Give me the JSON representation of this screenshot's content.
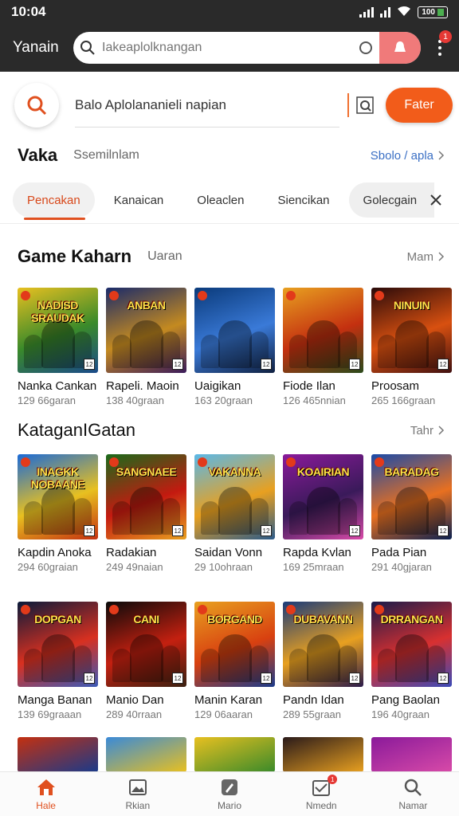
{
  "status_bar": {
    "time": "10:04",
    "battery": "100"
  },
  "header": {
    "app_title": "Yanain",
    "search_placeholder": "Iakeaplolknangan",
    "notification_count": "1"
  },
  "search_bar": {
    "query": "Balo Aplolananieli napian",
    "button_label": "Fater"
  },
  "section_main": {
    "title": "Vaka",
    "subtitle": "Ssemilnlam",
    "more_label": "Sbolo / apla"
  },
  "tabs": [
    {
      "label": "Pencakan",
      "active": true
    },
    {
      "label": "Kanaican",
      "active": false
    },
    {
      "label": "Oleaclen",
      "active": false
    },
    {
      "label": "Siencikan",
      "active": false
    },
    {
      "label": "Golecgain",
      "active": false
    }
  ],
  "section_games": {
    "title": "Game Kaharn",
    "subtitle": "Uaran",
    "more_label": "Mam"
  },
  "row1": [
    {
      "name": "Nanka Cankan",
      "meta": "129 66garan",
      "cover_title": "NADISD SRAUDAK",
      "colors": [
        "#e8c020",
        "#3a8a2a",
        "#1a4a8a"
      ]
    },
    {
      "name": "Rapeli. Maoin",
      "meta": "138 40graan",
      "cover_title": "ANBAN",
      "colors": [
        "#1a2a6a",
        "#c48a20",
        "#3a1a5a"
      ]
    },
    {
      "name": "Uaigikan",
      "meta": "163 20graan",
      "cover_title": "",
      "colors": [
        "#0a3a7a",
        "#3a7ad8",
        "#102040"
      ]
    },
    {
      "name": "Fiode Ilan",
      "meta": "126 465nnian",
      "cover_title": "",
      "colors": [
        "#e8a020",
        "#c43010",
        "#2a4a1a"
      ]
    },
    {
      "name": "Proosam",
      "meta": "265 166graan",
      "cover_title": "NINUIN",
      "colors": [
        "#2a0a0a",
        "#d85010",
        "#401010"
      ]
    }
  ],
  "section_categories": {
    "title": "KataganIGatan",
    "more_label": "Tahr"
  },
  "row2": [
    {
      "name": "Kapdin Anoka",
      "meta": "294 60graian",
      "cover_title": "INAGKK NOBAANE",
      "colors": [
        "#1a6ad8",
        "#e8c020",
        "#c43010"
      ]
    },
    {
      "name": "Radakian",
      "meta": "249 49naian",
      "cover_title": "SANGNAEE",
      "colors": [
        "#1a6a1a",
        "#c41a10",
        "#e8a020"
      ]
    },
    {
      "name": "Saidan Vonn",
      "meta": "29 10ohraan",
      "cover_title": "VAKANNA",
      "colors": [
        "#5ab8e8",
        "#e8a020",
        "#2a5a8a"
      ]
    },
    {
      "name": "Rapda Kvlan",
      "meta": "169 25mraan",
      "cover_title": "KOAIRIAN",
      "colors": [
        "#8a1a9a",
        "#3a1a5a",
        "#d84aa8"
      ]
    },
    {
      "name": "Pada Pian",
      "meta": "291 40gjaran",
      "cover_title": "BARADAG",
      "colors": [
        "#1a4aa8",
        "#e87020",
        "#0a2050"
      ]
    }
  ],
  "row3": [
    {
      "name": "Manga Banan",
      "meta": "139 69graaan",
      "cover_title": "DOPGAN",
      "colors": [
        "#0a1a3a",
        "#d83020",
        "#3a5ab8"
      ]
    },
    {
      "name": "Manio Dan",
      "meta": "289 40rraan",
      "cover_title": "CANI",
      "colors": [
        "#0a0a0a",
        "#c42010",
        "#3a2010"
      ]
    },
    {
      "name": "Manin Karan",
      "meta": "129 06aaran",
      "cover_title": "BORGAND",
      "colors": [
        "#e8a020",
        "#d84010",
        "#1a3a8a"
      ]
    },
    {
      "name": "Pandn Idan",
      "meta": "289 55graan",
      "cover_title": "DUBAVANN",
      "colors": [
        "#1a3a7a",
        "#e8a020",
        "#2a1a4a"
      ]
    },
    {
      "name": "Pang Baolan",
      "meta": "196 40graan",
      "cover_title": "DRRANGAN",
      "colors": [
        "#1a1a4a",
        "#d83030",
        "#3a4ab8"
      ]
    }
  ],
  "row4_colors": [
    [
      "#c43010",
      "#1a3a8a"
    ],
    [
      "#3a8ad8",
      "#e8c020"
    ],
    [
      "#e8c020",
      "#3a8a2a"
    ],
    [
      "#2a1a1a",
      "#e8a020"
    ],
    [
      "#8a1a9a",
      "#d84aa8"
    ]
  ],
  "bottom_nav": [
    {
      "label": "Hale",
      "active": true
    },
    {
      "label": "Rkian",
      "active": false
    },
    {
      "label": "Mario",
      "active": false
    },
    {
      "label": "Nmedn",
      "active": false,
      "badge": "1"
    },
    {
      "label": "Namar",
      "active": false
    }
  ],
  "colors": {
    "accent": "#f25c1a",
    "header_bg": "#2a2a2a",
    "link": "#3a6fc4"
  }
}
